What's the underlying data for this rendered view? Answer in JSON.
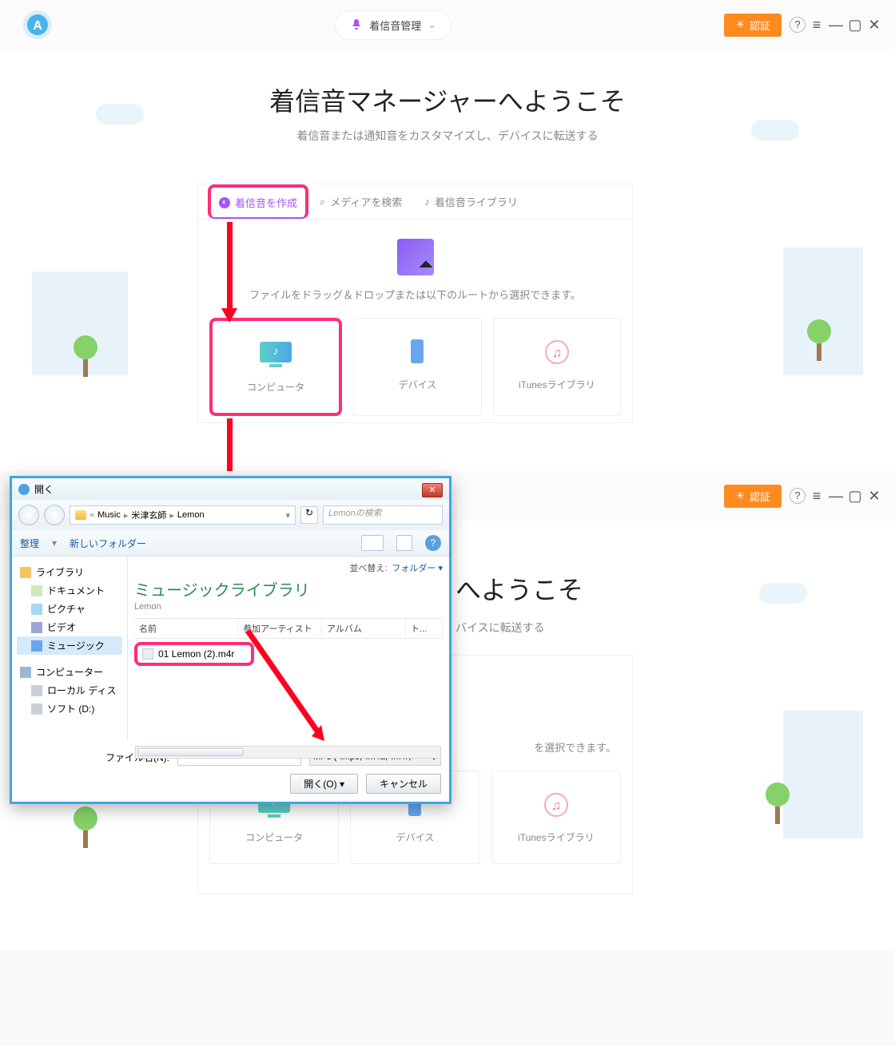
{
  "topApp": {
    "chip": "着信音管理",
    "authBtn": "認証",
    "heroTitle": "着信音マネージャーへようこそ",
    "heroSub": "着信音または通知音をカスタマイズし、デバイスに転送する",
    "tabs": {
      "create": "着信音を作成",
      "search": "メディアを検索",
      "library": "着信音ライブラリ"
    },
    "dropHint": "ファイルをドラッグ＆ドロップまたは以下のルートから選択できます。",
    "sources": {
      "computer": "コンピュータ",
      "device": "デバイス",
      "itunes": "iTunesライブラリ"
    },
    "cardHint2": "を選択できます。"
  },
  "dialog": {
    "title": "開く",
    "crumbs": [
      "Music",
      "米津玄師",
      "Lemon"
    ],
    "searchPlaceholder": "Lemonの検索",
    "toolbar": {
      "organize": "整理",
      "newFolder": "新しいフォルダー"
    },
    "sidebar": {
      "library": "ライブラリ",
      "documents": "ドキュメント",
      "pictures": "ピクチャ",
      "video": "ビデオ",
      "music": "ミュージック",
      "computer": "コンピューター",
      "localDisk": "ローカル ディス",
      "softD": "ソフト (D:)"
    },
    "pane": {
      "title": "ミュージックライブラリ",
      "subtitle": "Lemon",
      "sortLabel": "並べ替え:",
      "sortValue": "フォルダー",
      "cols": {
        "name": "名前",
        "artist": "参加アーティスト",
        "album": "アルバム",
        "track": "ト..."
      },
      "file": "01 Lemon (2).m4r"
    },
    "footer": {
      "fileLabel": "ファイル名(N):",
      "filter": "MP3 (*.mp3;*.m4a;*.m4r;*",
      "open": "開く(O)",
      "cancel": "キャンセル"
    }
  }
}
